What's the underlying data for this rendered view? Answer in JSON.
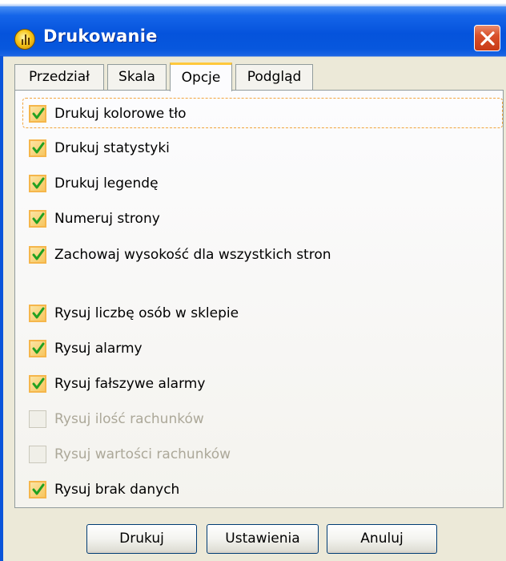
{
  "window": {
    "title": "Drukowanie",
    "icon": "app-icon",
    "close_icon": "close-icon"
  },
  "tabs": [
    {
      "label": "Przedział",
      "active": false
    },
    {
      "label": "Skala",
      "active": false
    },
    {
      "label": "Opcje",
      "active": true
    },
    {
      "label": "Podgląd",
      "active": false
    }
  ],
  "options": [
    {
      "label": "Drukuj kolorowe tło",
      "checked": true,
      "enabled": true
    },
    {
      "label": "Drukuj statystyki",
      "checked": true,
      "enabled": true
    },
    {
      "label": "Drukuj legendę",
      "checked": true,
      "enabled": true
    },
    {
      "label": "Numeruj strony",
      "checked": true,
      "enabled": true
    },
    {
      "label": "Zachowaj wysokość dla wszystkich stron",
      "checked": true,
      "enabled": true
    },
    {
      "label": "Rysuj liczbę osób w sklepie",
      "checked": true,
      "enabled": true
    },
    {
      "label": "Rysuj alarmy",
      "checked": true,
      "enabled": true
    },
    {
      "label": "Rysuj fałszywe alarmy",
      "checked": true,
      "enabled": true
    },
    {
      "label": "Rysuj ilość rachunków",
      "checked": false,
      "enabled": false
    },
    {
      "label": "Rysuj wartości rachunków",
      "checked": false,
      "enabled": false
    },
    {
      "label": "Rysuj brak danych",
      "checked": true,
      "enabled": true
    }
  ],
  "buttons": {
    "print": "Drukuj",
    "settings": "Ustawienia",
    "cancel": "Anuluj"
  },
  "colors": {
    "title_bar": "#0553dc",
    "dialog_bg": "#ece9d8",
    "check_accent": "#f5b64b",
    "active_tab_accent": "#ffc83c",
    "disabled_text": "#aca899"
  }
}
